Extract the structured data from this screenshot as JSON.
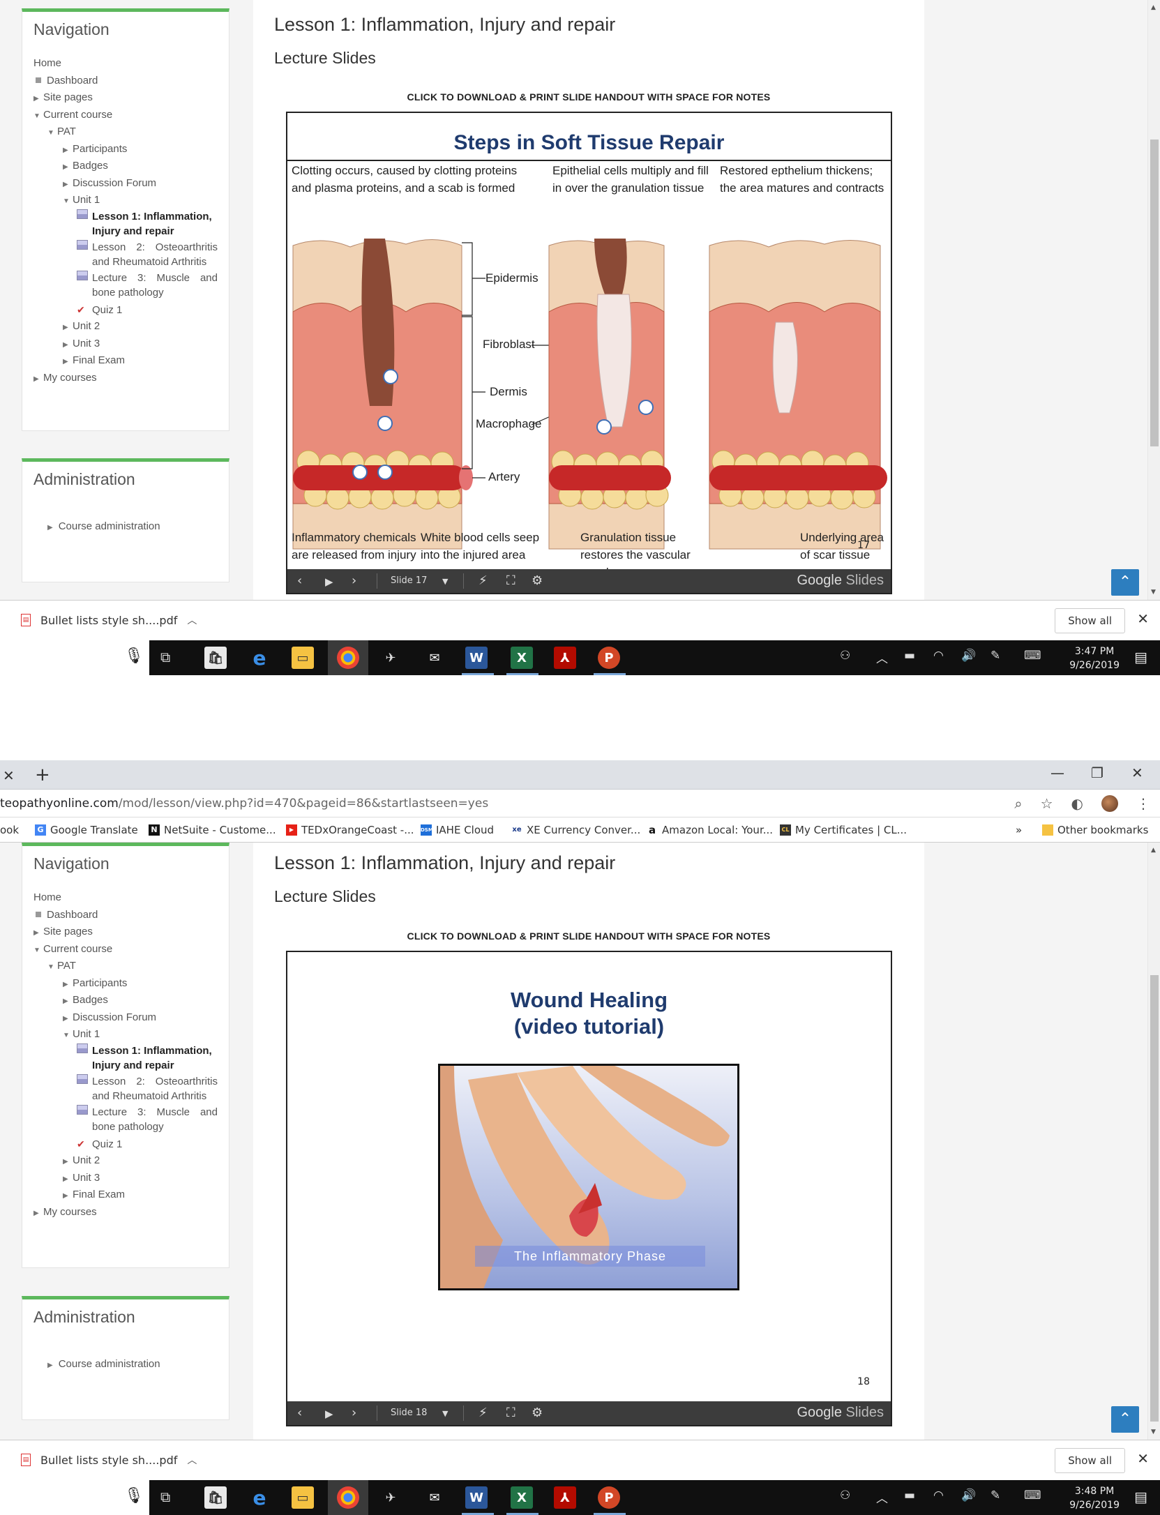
{
  "chrome": {
    "url_domain": "teopathyonline.com",
    "url_path": "/mod/lesson/view.php?id=470&pageid=86&startlastseen=yes",
    "new_tab": "+",
    "bookmarks": [
      {
        "label": "ook",
        "icon": ""
      },
      {
        "label": "Google Translate",
        "icon": "G"
      },
      {
        "label": "NetSuite - Custome...",
        "icon": "N"
      },
      {
        "label": "TEDxOrangeCoast -...",
        "icon": "▶"
      },
      {
        "label": "IAHE Cloud",
        "icon": "DSM"
      },
      {
        "label": "XE Currency Conver...",
        "icon": "xe"
      },
      {
        "label": "Amazon Local: Your...",
        "icon": "a"
      },
      {
        "label": "My Certificates | CL...",
        "icon": "CL"
      }
    ],
    "more_bookmarks": "»",
    "other_bookmarks": "Other bookmarks"
  },
  "nav": {
    "title": "Navigation",
    "home": "Home",
    "dashboard": "Dashboard",
    "site_pages": "Site pages",
    "current_course": "Current course",
    "course": "PAT",
    "participants": "Participants",
    "badges": "Badges",
    "forum": "Discussion Forum",
    "unit1": "Unit 1",
    "lesson1": "Lesson 1: Inflammation, Injury and repair",
    "lesson2": "Lesson 2: Osteoarthritis and Rheumatoid Arthritis",
    "lecture3": "Lecture 3: Muscle and bone pathology",
    "quiz1": "Quiz 1",
    "unit2": "Unit 2",
    "unit3": "Unit 3",
    "final": "Final Exam",
    "my_courses": "My courses"
  },
  "admin": {
    "title": "Administration",
    "course_admin": "Course administration"
  },
  "content": {
    "lesson_title": "Lesson 1: Inflammation, Injury and repair",
    "subtitle": "Lecture Slides",
    "download": "CLICK TO DOWNLOAD & PRINT SLIDE HANDOUT WITH SPACE FOR NOTES"
  },
  "slide1": {
    "title": "Steps in Soft Tissue Repair",
    "cap1": "Clotting occurs, caused by clotting proteins and plasma proteins, and a scab is formed",
    "cap2": "Epithelial cells multiply and fill in over the granulation tissue",
    "cap3": "Restored epthelium thickens; the area matures and contracts",
    "label_epidermis": "Epidermis",
    "label_fibroblast": "Fibroblast",
    "label_dermis": "Dermis",
    "label_macrophage": "Macrophage",
    "label_artery": "Artery",
    "bottom1": "Inflammatory chemicals are released from injury",
    "bottom2": "White blood cells seep into the injured area",
    "bottom3": "Granulation tissue restores the vascular supply",
    "bottom4": "Underlying area of scar tissue",
    "page_no": "17",
    "toolbar_slide": "Slide 17"
  },
  "slide2": {
    "title_line1": "Wound Healing",
    "title_line2": "(video tutorial)",
    "video_caption": "The Inflammatory Phase",
    "page_no": "18",
    "toolbar_slide": "Slide 18"
  },
  "toolbar": {
    "brand_google": "Google",
    "brand_slides": " Slides"
  },
  "download_bar": {
    "file": "Bullet lists style sh....pdf",
    "show_all": "Show all"
  },
  "taskbar1": {
    "time": "3:47 PM",
    "date": "9/26/2019"
  },
  "taskbar2": {
    "time": "3:48 PM",
    "date": "9/26/2019"
  },
  "colors": {
    "block_accent": "#5cb85c",
    "slide_title": "#1f3b6e",
    "to_top": "#2d7ebf",
    "skin": "#f1d3b5",
    "dermis": "#e98c7b",
    "artery": "#c62828",
    "fat": "#f5dc9a"
  }
}
